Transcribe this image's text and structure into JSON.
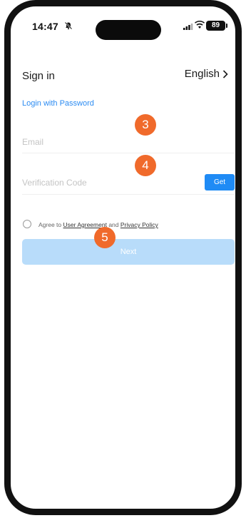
{
  "status_bar": {
    "time": "14:47",
    "battery": "89",
    "icons": [
      "bell-muted-icon",
      "signal-icon",
      "wifi-icon",
      "battery-icon"
    ]
  },
  "header": {
    "title": "Sign in",
    "language": "English"
  },
  "login_with_password": "Login with Password",
  "email": {
    "placeholder": "Email"
  },
  "verification": {
    "placeholder": "Verification Code",
    "get_label": "Get"
  },
  "agreement": {
    "prefix": "Agree to",
    "user_agreement": "User Agreement",
    "and": "and",
    "privacy_policy": "Privacy Policy"
  },
  "next_label": "Next",
  "markers": [
    "3",
    "4",
    "5"
  ],
  "colors": {
    "accent": "#1f8bf5",
    "link": "#2b8bf2",
    "next_disabled": "#b8dcfa",
    "marker": "#f06a2b"
  }
}
